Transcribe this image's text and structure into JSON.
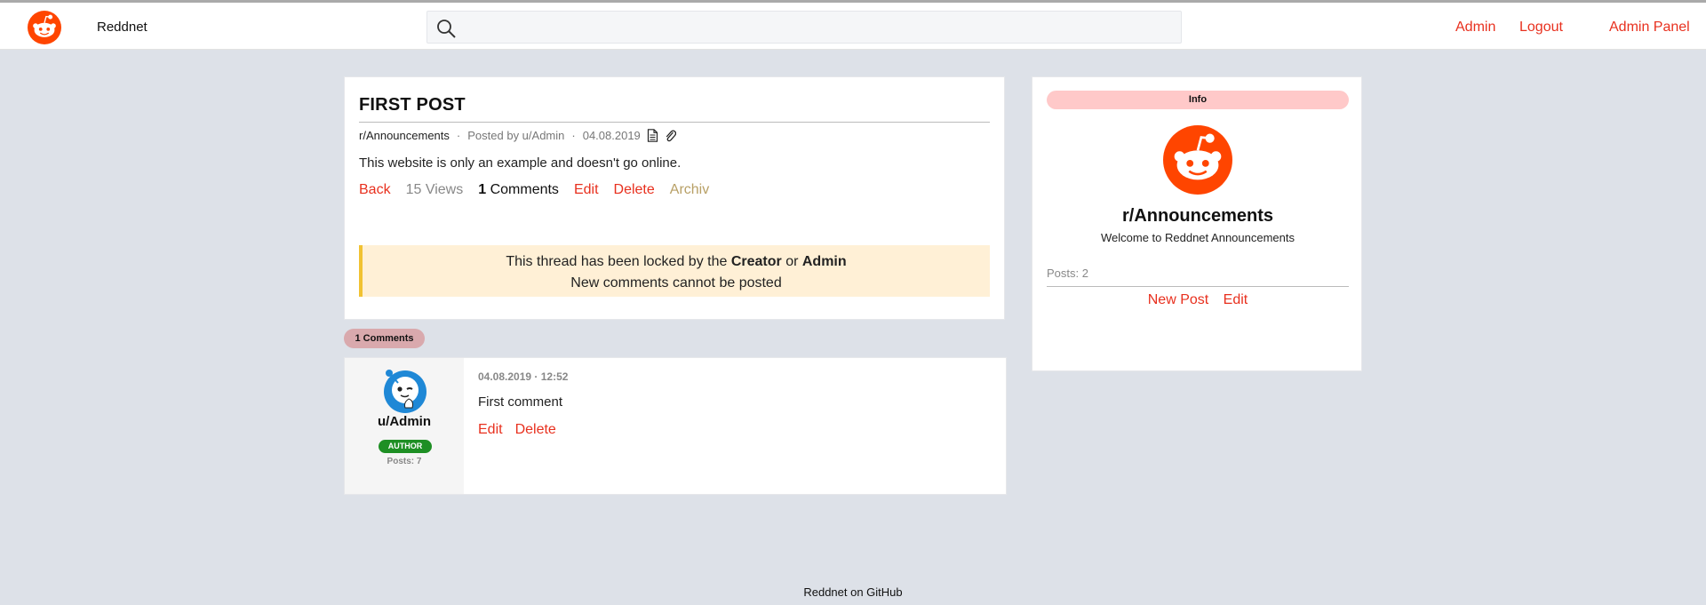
{
  "header": {
    "brand": "Reddnet",
    "search_placeholder": "",
    "nav": {
      "user": "Admin",
      "logout": "Logout",
      "admin_panel": "Admin Panel"
    }
  },
  "post": {
    "title": "FIRST POST",
    "subreddit": "r/Announcements",
    "posted_by": "Posted by u/Admin",
    "date": "04.08.2019",
    "body": "This website is only an example and doesn't go online.",
    "actions": {
      "back": "Back",
      "views": "15 Views",
      "comments_count": "1",
      "comments_label": "Comments",
      "edit": "Edit",
      "delete": "Delete",
      "archive": "Archiv"
    },
    "lock_notice": {
      "prefix": "This thread has been locked by the",
      "creator": "Creator",
      "or": "or",
      "admin": "Admin",
      "line2": "New comments cannot be posted"
    }
  },
  "comments_header": "1 Comments",
  "comments": [
    {
      "user": "u/Admin",
      "badge": "AUTHOR",
      "posts": "Posts: 7",
      "datetime": "04.08.2019 · 12:52",
      "text": "First comment",
      "edit": "Edit",
      "delete": "Delete"
    }
  ],
  "sidebar": {
    "info_label": "Info",
    "name": "r/Announcements",
    "description": "Welcome to Reddnet Announcements",
    "posts": "Posts: 2",
    "new_post": "New Post",
    "edit": "Edit"
  },
  "footer": "Reddnet on GitHub",
  "colors": {
    "accent": "#e8301e",
    "page_bg": "#dde1e8",
    "author_badge": "#1e8f24",
    "avatar_blue": "#1f88d6"
  },
  "icons": [
    "reddit-logo-icon",
    "search-icon",
    "document-icon",
    "paperclip-icon",
    "user-avatar-icon"
  ]
}
